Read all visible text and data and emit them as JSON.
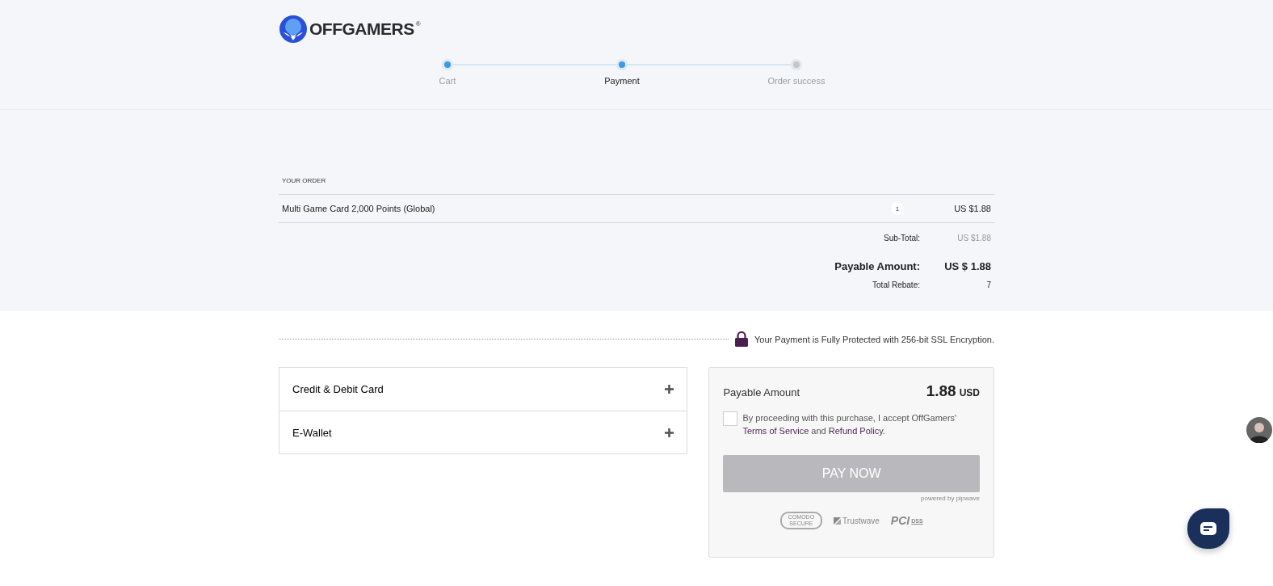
{
  "logo": {
    "text": "OFFGAMERS",
    "mark": "®"
  },
  "steps": [
    {
      "label": "Cart",
      "reached": true,
      "selected": false
    },
    {
      "label": "Payment",
      "reached": true,
      "selected": true
    },
    {
      "label": "Order success",
      "reached": false,
      "selected": false
    }
  ],
  "order": {
    "heading": "YOUR ORDER",
    "items": [
      {
        "name": "Multi Game Card 2,000 Points (Global)",
        "quantity": "1",
        "price": "US $1.88"
      }
    ],
    "subtotal": {
      "label": "Sub-Total:",
      "value": "US $1.88"
    },
    "payable": {
      "label": "Payable Amount:",
      "value": "US $ 1.88"
    },
    "rebate": {
      "label": "Total Rebate:",
      "value": "7"
    }
  },
  "security_note": "Your Payment is Fully Protected with 256-bit SSL Encryption.",
  "payment_methods": [
    {
      "label": "Credit & Debit Card",
      "expanded": false
    },
    {
      "label": "E-Wallet",
      "expanded": false
    }
  ],
  "summary": {
    "label": "Payable Amount",
    "amount": "1.88",
    "currency": "USD",
    "accepted": false,
    "terms_before": "By proceeding with this purchase, I accept OffGamers' ",
    "terms_link": "Terms of Service",
    "terms_middle": " and ",
    "refund_link": "Refund Policy",
    "terms_after": ".",
    "button": "PAY NOW",
    "button_disabled": true,
    "powered_by": "powered by pipwave",
    "badges": [
      {
        "kind": "comodo",
        "texts": [
          "COMODO",
          "SECURE"
        ]
      },
      {
        "kind": "trustwave",
        "texts": [
          "Trustwave"
        ]
      },
      {
        "kind": "pci",
        "texts": [
          "PCI",
          "DSS"
        ]
      }
    ]
  }
}
